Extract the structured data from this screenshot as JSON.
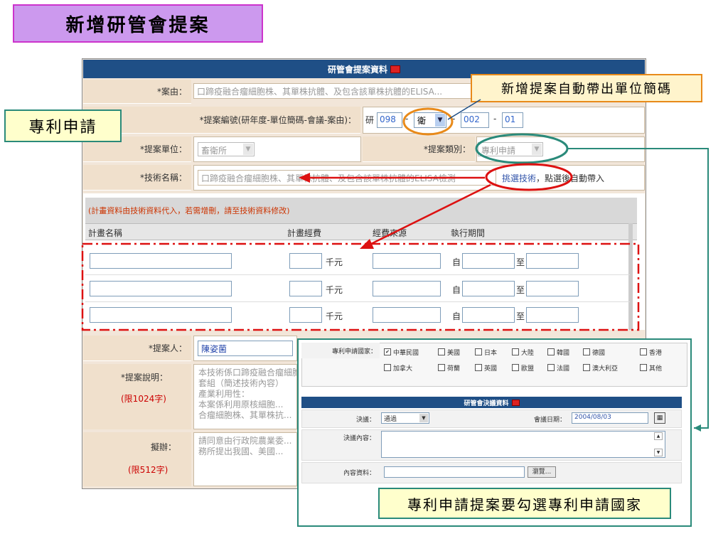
{
  "slide": {
    "title": "新增研管會提案"
  },
  "form": {
    "header": "研管會提案資料",
    "case_reason_label": "*案由：",
    "case_reason_value": "口蹄疫融合瘤細胞株、其單株抗體、及包含該單株抗體的ELISA...",
    "proposal_no_label": "*提案編號(研年度-單位簡碼-會議-案由)：",
    "proposal_no": {
      "prefix": "研",
      "year": "098",
      "unit": "衛",
      "meeting": "002",
      "case": "01",
      "sep": "-"
    },
    "unit_label": "*提案單位：",
    "unit_value": "畜衛所",
    "category_label": "*提案類別：",
    "category_value": "專利申請",
    "tech_label": "*技術名稱：",
    "tech_value": "口蹄疫融合瘤細胞株、其單株抗體、及包含該單株抗體的ELISA檢測",
    "tech_note_pre": "挑選技術",
    "tech_note_post": "，點選後自動帶入",
    "plan_note": "(計畫資料由技術資料代入，若需增刪，請至技術資料修改)",
    "plan_headers": [
      "計畫名稱",
      "計畫經費",
      "經費來源",
      "執行期間"
    ],
    "plan_rows": [
      {
        "unit": "千元",
        "from": "自",
        "to": "至"
      },
      {
        "unit": "千元",
        "from": "自",
        "to": "至"
      },
      {
        "unit": "千元",
        "from": "自",
        "to": "至"
      }
    ],
    "proposer_label": "*提案人：",
    "proposer_value": "陳姿菌",
    "desc_label": "*提案說明：",
    "desc_limit": "(限1024字)",
    "desc_lines": [
      "本技術係口蹄疫融合瘤細胞株...",
      "套組（簡述技術內容）",
      "產業利用性：",
      "本案係利用原核細胞...",
      "合瘤細胞株、其單株抗..."
    ],
    "plan_label": "擬辦：",
    "plan_limit": "(限512字)",
    "plan_lines": [
      "請同意由行政院農業委...",
      "務所提出我國、美國..."
    ]
  },
  "callouts": {
    "auto_unit": "新增提案自動帶出單位簡碼",
    "patent": "專利申請",
    "select_country": "專利申請提案要勾選專利申請國家"
  },
  "popup": {
    "country_label": "專利申請國家：",
    "countries_row1": [
      {
        "name": "中華民國",
        "checked": true
      },
      {
        "name": "美國",
        "checked": false
      },
      {
        "name": "日本",
        "checked": false
      },
      {
        "name": "大陸",
        "checked": false
      },
      {
        "name": "韓國",
        "checked": false
      },
      {
        "name": "德國",
        "checked": false
      },
      {
        "name": "香港",
        "checked": false
      }
    ],
    "countries_row2": [
      {
        "name": "加拿大",
        "checked": false
      },
      {
        "name": "荷蘭",
        "checked": false
      },
      {
        "name": "英國",
        "checked": false
      },
      {
        "name": "歐盟",
        "checked": false
      },
      {
        "name": "法國",
        "checked": false
      },
      {
        "name": "澳大利亞",
        "checked": false
      },
      {
        "name": "其他",
        "checked": false
      }
    ],
    "resolution_header": "研管會決議資料",
    "resolution_label": "決議：",
    "resolution_value": "通過",
    "meeting_date_label": "會議日期：",
    "meeting_date_value": "2004/08/03",
    "resolution_content_label": "決議內容：",
    "content_data_label": "內容資料：",
    "browse_label": "瀏覽..."
  },
  "colors": {
    "header_bg": "#1f4f86",
    "label_bg": "#f0e0cc",
    "red_annotation": "#dd1111",
    "orange_annotation": "#e88a1a",
    "teal_annotation": "#2a8a7a"
  }
}
